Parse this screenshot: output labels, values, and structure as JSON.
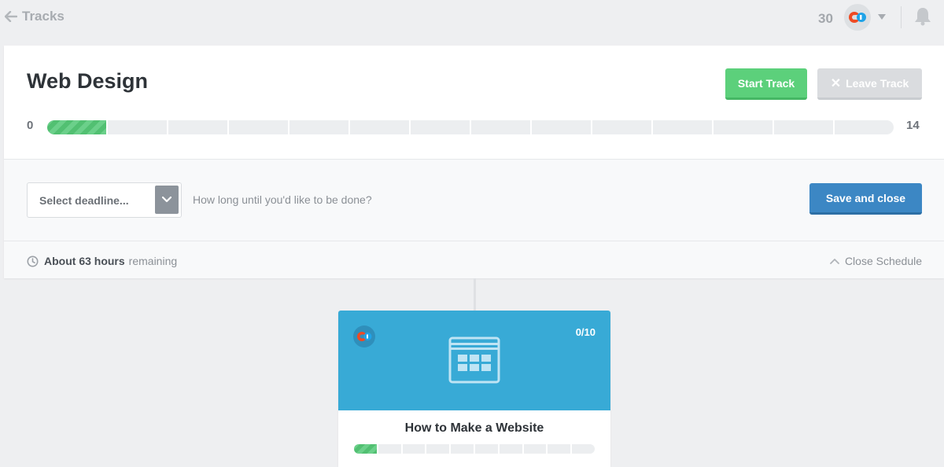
{
  "topbar": {
    "back_label": "Tracks",
    "points": "30"
  },
  "track": {
    "title": "Web Design",
    "start_label": "Start Track",
    "leave_label": "Leave Track",
    "progress_min": "0",
    "progress_max": "14",
    "progress_completed": 1,
    "progress_total": 14
  },
  "schedule": {
    "deadline_placeholder": "Select deadline...",
    "deadline_hint": "How long until you'd like to be done?",
    "save_label": "Save and close",
    "remaining_bold": "About 63 hours",
    "remaining_suffix": "remaining",
    "close_label": "Close Schedule"
  },
  "course": {
    "title": "How to Make a Website",
    "count": "0/10",
    "progress_completed": 1,
    "progress_total": 10
  },
  "colors": {
    "accent_green": "#5cd07b",
    "accent_blue": "#3c87c4",
    "course_blue": "#38aad6"
  }
}
